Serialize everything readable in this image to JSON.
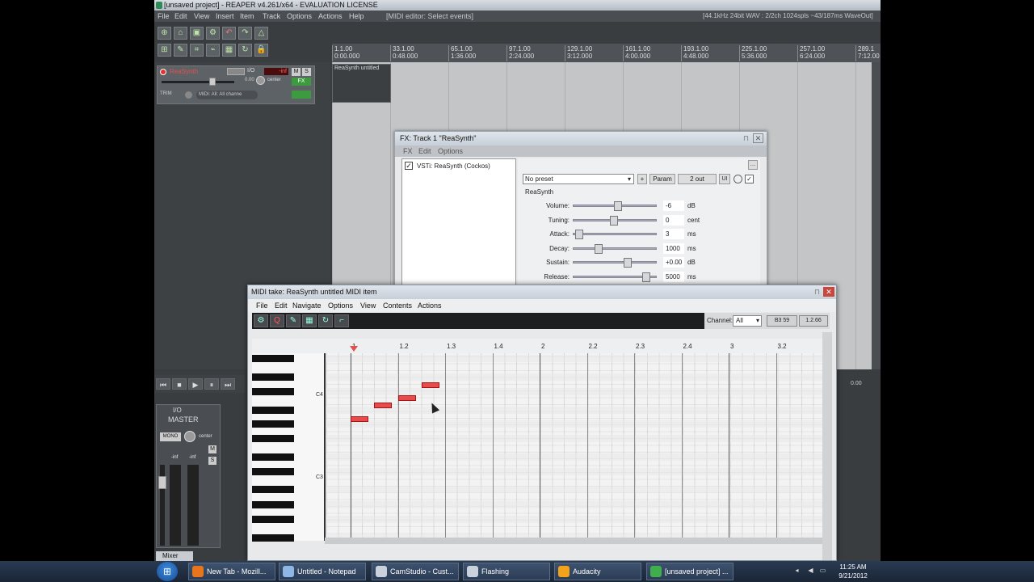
{
  "reaper": {
    "title": "[unsaved project] - REAPER v4.261/x64 - EVALUATION LICENSE",
    "menu": [
      "File",
      "Edit",
      "View",
      "Insert",
      "Item",
      "Track",
      "Options",
      "Actions",
      "Help"
    ],
    "midi_status": "[MIDI editor: Select events]",
    "audio_info": "[44.1kHz 24bit WAV : 2/2ch 1024spls ~43/187ms WaveOut]",
    "ruler_ticks": [
      {
        "bar": "1.1.00",
        "time": "0:00.000"
      },
      {
        "bar": "33.1.00",
        "time": "0:48.000"
      },
      {
        "bar": "65.1.00",
        "time": "1:36.000"
      },
      {
        "bar": "97.1.00",
        "time": "2:24.000"
      },
      {
        "bar": "129.1.00",
        "time": "3:12.000"
      },
      {
        "bar": "161.1.00",
        "time": "4:00.000"
      },
      {
        "bar": "193.1.00",
        "time": "4:48.000"
      },
      {
        "bar": "225.1.00",
        "time": "5:36.000"
      },
      {
        "bar": "257.1.00",
        "time": "6:24.000"
      },
      {
        "bar": "289.1",
        "time": "7:12.00"
      }
    ],
    "track1": {
      "name": "ReaSynth",
      "io": "I/O",
      "volume": "-inf",
      "gain": "0.00",
      "pan": "center",
      "mute": "M",
      "solo": "S",
      "fx": "FX",
      "trim": "TRIM",
      "midi_input": "MIDI: All: All channe"
    },
    "item_label": "ReaSynth untitled",
    "master": {
      "label": "MASTER",
      "io": "I/O",
      "mono": "MONO",
      "pan": "center",
      "mute": "M",
      "solo": "S",
      "peak_l": "-inf",
      "peak_r": "-inf"
    },
    "mixer_tab": "Mixer",
    "transport_buttons": [
      "⏮",
      "■",
      "▶",
      "⏸",
      "⏭"
    ],
    "right_value": "0.00"
  },
  "fx": {
    "title": "FX: Track 1 \"ReaSynth\"",
    "menu": [
      "FX",
      "Edit",
      "Options"
    ],
    "plugin": "VSTi: ReaSynth (Cockos)",
    "preset": "No preset",
    "plus": "+",
    "param_btn": "Param",
    "out_btn": "2 out",
    "ui_btn": "UI",
    "synth_name": "ReaSynth",
    "params": [
      {
        "label": "Volume:",
        "value": "-6",
        "unit": "dB",
        "pos": 0.55
      },
      {
        "label": "Tuning:",
        "value": "0",
        "unit": "cent",
        "pos": 0.5
      },
      {
        "label": "Attack:",
        "value": "3",
        "unit": "ms",
        "pos": 0.05
      },
      {
        "label": "Decay:",
        "value": "1000",
        "unit": "ms",
        "pos": 0.3
      },
      {
        "label": "Sustain:",
        "value": "+0.00",
        "unit": "dB",
        "pos": 0.68
      },
      {
        "label": "Release:",
        "value": "5000",
        "unit": "ms",
        "pos": 0.92
      }
    ]
  },
  "midi": {
    "title": "MIDI take: ReaSynth untitled MIDI item",
    "menu": [
      "File",
      "Edit",
      "Navigate",
      "Options",
      "View",
      "Contents",
      "Actions"
    ],
    "channel_label": "Channel:",
    "channel_value": "All",
    "pos1": "B3  59",
    "pos2": "1.2.66",
    "ruler": [
      "1",
      "1.2",
      "1.3",
      "1.4",
      "2",
      "2.2",
      "2.3",
      "2.4",
      "3",
      "3.2"
    ],
    "key_labels": [
      "C4",
      "C3"
    ],
    "notes": [
      {
        "start_beat": 1.0,
        "pitch_row": 9
      },
      {
        "start_beat": 1.5,
        "pitch_row": 7
      },
      {
        "start_beat": 2.0,
        "pitch_row": 6
      },
      {
        "start_beat": 2.5,
        "pitch_row": 4
      }
    ]
  },
  "taskbar": {
    "tasks": [
      {
        "label": "New Tab - Mozill...",
        "color": "#e8741c"
      },
      {
        "label": "Untitled - Notepad",
        "color": "#8fb7e6"
      },
      {
        "label": "CamStudio - Cust...",
        "color": "#c9d2dc"
      },
      {
        "label": "Flashing",
        "color": "#c9d2dc"
      },
      {
        "label": "Audacity",
        "color": "#f2a31b"
      },
      {
        "label": "[unsaved project] ...",
        "color": "#3fae4d"
      }
    ],
    "time": "11:25 AM",
    "date": "9/21/2012"
  }
}
